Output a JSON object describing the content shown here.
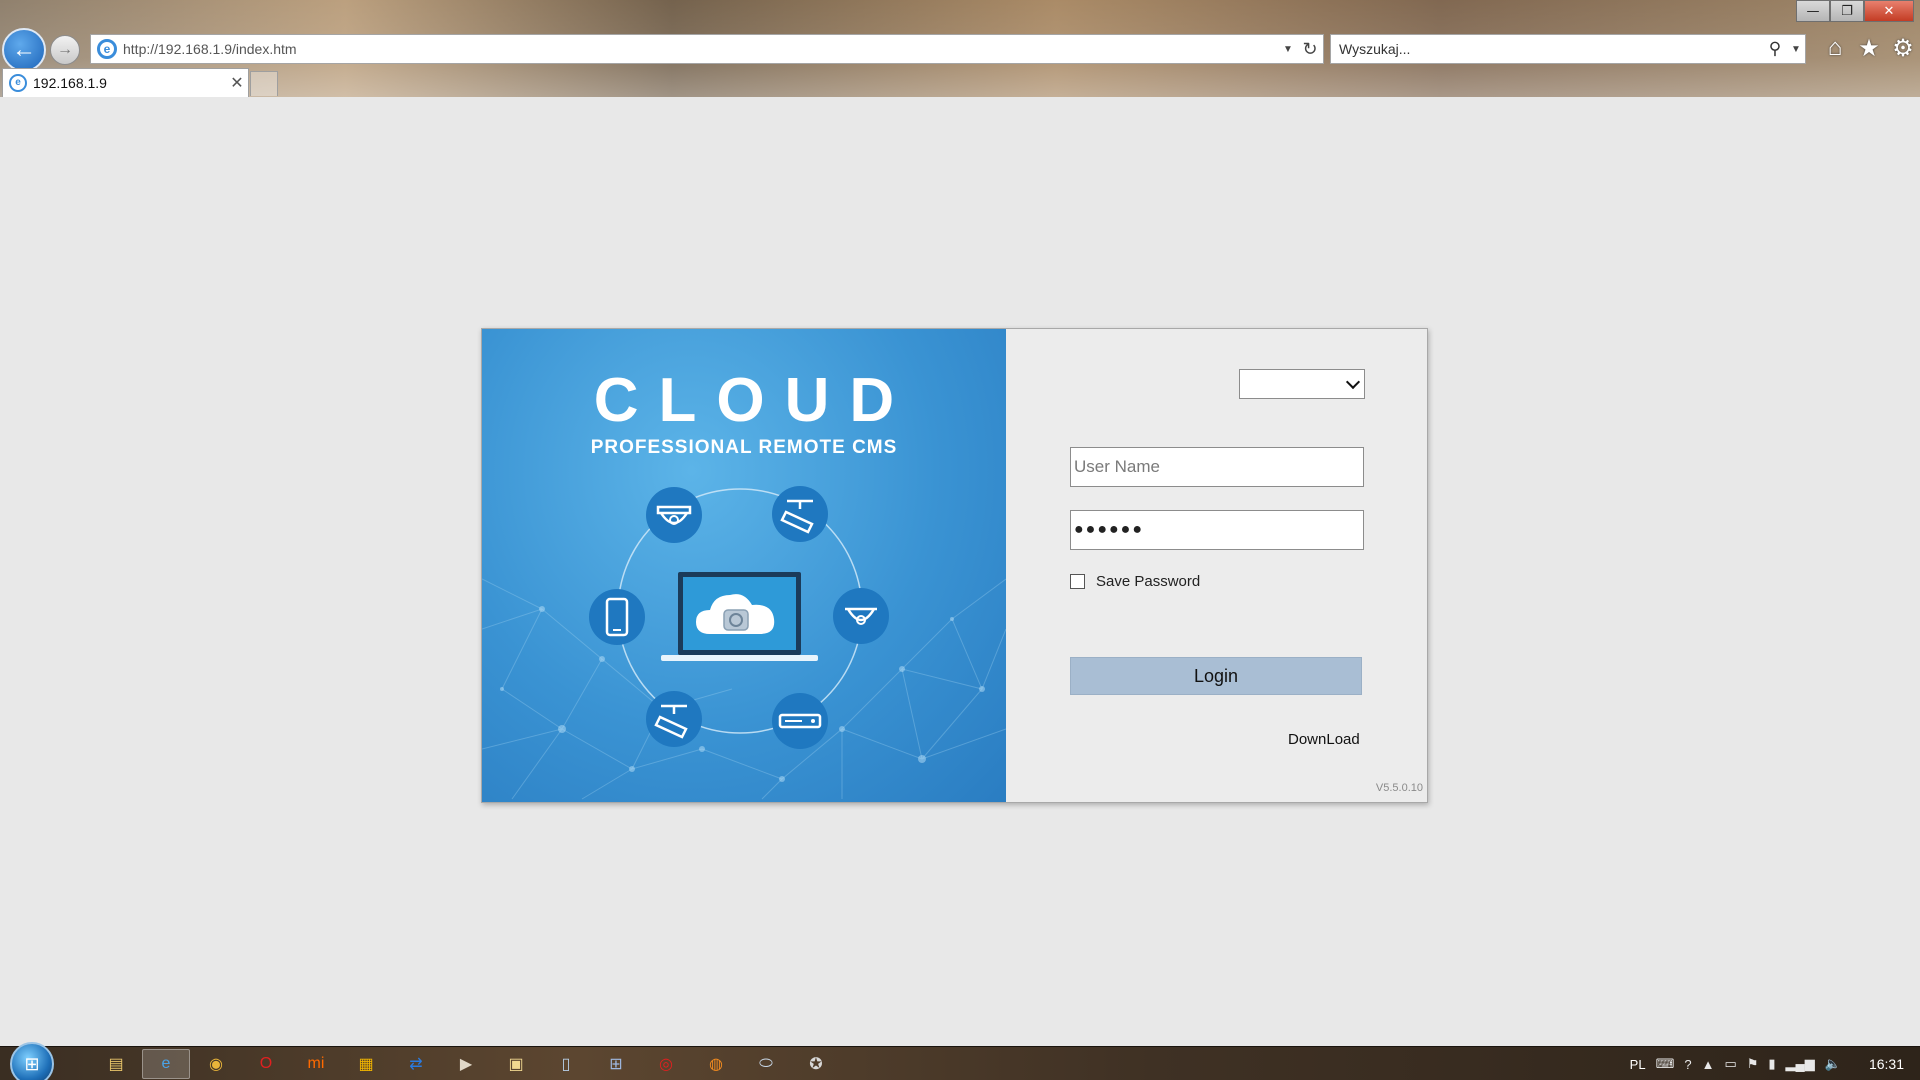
{
  "browser": {
    "address": {
      "url": "http://192.168.1.9/index.htm"
    },
    "search": {
      "placeholder": "Wyszukaj..."
    },
    "tab": {
      "title": "192.168.1.9"
    },
    "window_controls": {
      "minimize": "—",
      "restore": "❐",
      "close": "✕"
    }
  },
  "banner": {
    "title": "CLOUD",
    "subtitle": "PROFESSIONAL REMOTE CMS"
  },
  "login": {
    "language_value": "",
    "username_placeholder": "User Name",
    "password_value": "●●●●●●",
    "save_password_label": "Save Password",
    "save_password_checked": false,
    "login_button": "Login",
    "download_link": "DownLoad",
    "version": "V5.5.0.10"
  },
  "taskbar": {
    "items": [
      {
        "icon": "file-explorer-icon",
        "glyph": "▤",
        "color": "#e8c56a"
      },
      {
        "icon": "internet-explorer-icon",
        "glyph": "e",
        "color": "#4aa3e6",
        "active": true
      },
      {
        "icon": "chrome-icon",
        "glyph": "◉",
        "color": "#e8b43a"
      },
      {
        "icon": "opera-icon",
        "glyph": "O",
        "color": "#e02020"
      },
      {
        "icon": "mi-icon",
        "glyph": "mi",
        "color": "#ff6a00"
      },
      {
        "icon": "windows-store-icon",
        "glyph": "▦",
        "color": "#f0b400"
      },
      {
        "icon": "teamviewer-icon",
        "glyph": "⇄",
        "color": "#2a7be0"
      },
      {
        "icon": "media-player-icon",
        "glyph": "▶",
        "color": "#e0d8c8"
      },
      {
        "icon": "folder-icon",
        "glyph": "▣",
        "color": "#f0d890"
      },
      {
        "icon": "notepad-icon",
        "glyph": "▯",
        "color": "#b8d0e8"
      },
      {
        "icon": "network-icon",
        "glyph": "⊞",
        "color": "#9fb8e0"
      },
      {
        "icon": "record-icon",
        "glyph": "◎",
        "color": "#e02020"
      },
      {
        "icon": "firefox-icon",
        "glyph": "◍",
        "color": "#f08a20"
      },
      {
        "icon": "vpn-icon",
        "glyph": "⬭",
        "color": "#c8d8e8"
      },
      {
        "icon": "app-icon",
        "glyph": "✪",
        "color": "#d8d8d8"
      }
    ],
    "tray": {
      "language": "PL",
      "time": "16:31"
    }
  },
  "colors": {
    "banner_blue": "#3a93d3",
    "login_button_bg": "#a9bed4",
    "page_bg": "#e8e8e8",
    "icon_circle": "#1f78c0"
  }
}
